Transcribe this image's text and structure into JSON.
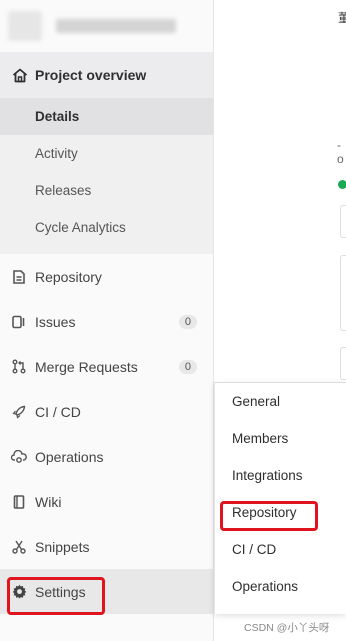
{
  "sidebar": {
    "overview": {
      "label": "Project overview",
      "items": [
        "Details",
        "Activity",
        "Releases",
        "Cycle Analytics"
      ]
    },
    "items": [
      {
        "label": "Repository",
        "icon": "document-icon"
      },
      {
        "label": "Issues",
        "icon": "issues-icon",
        "count": "0"
      },
      {
        "label": "Merge Requests",
        "icon": "merge-request-icon",
        "count": "0"
      },
      {
        "label": "CI / CD",
        "icon": "rocket-icon"
      },
      {
        "label": "Operations",
        "icon": "cloud-gear-icon"
      },
      {
        "label": "Wiki",
        "icon": "book-icon"
      },
      {
        "label": "Snippets",
        "icon": "scissors-icon"
      },
      {
        "label": "Settings",
        "icon": "gear-icon"
      }
    ]
  },
  "flyout": {
    "items": [
      "General",
      "Members",
      "Integrations",
      "Repository",
      "CI / CD",
      "Operations"
    ]
  },
  "main": {
    "title_fragment": "董"
  },
  "footer": "CSDN @小丫头呀",
  "colors": {
    "highlight": "#e0141e",
    "status_green": "#1aaa55",
    "sidebar_bg": "#fafafa"
  }
}
